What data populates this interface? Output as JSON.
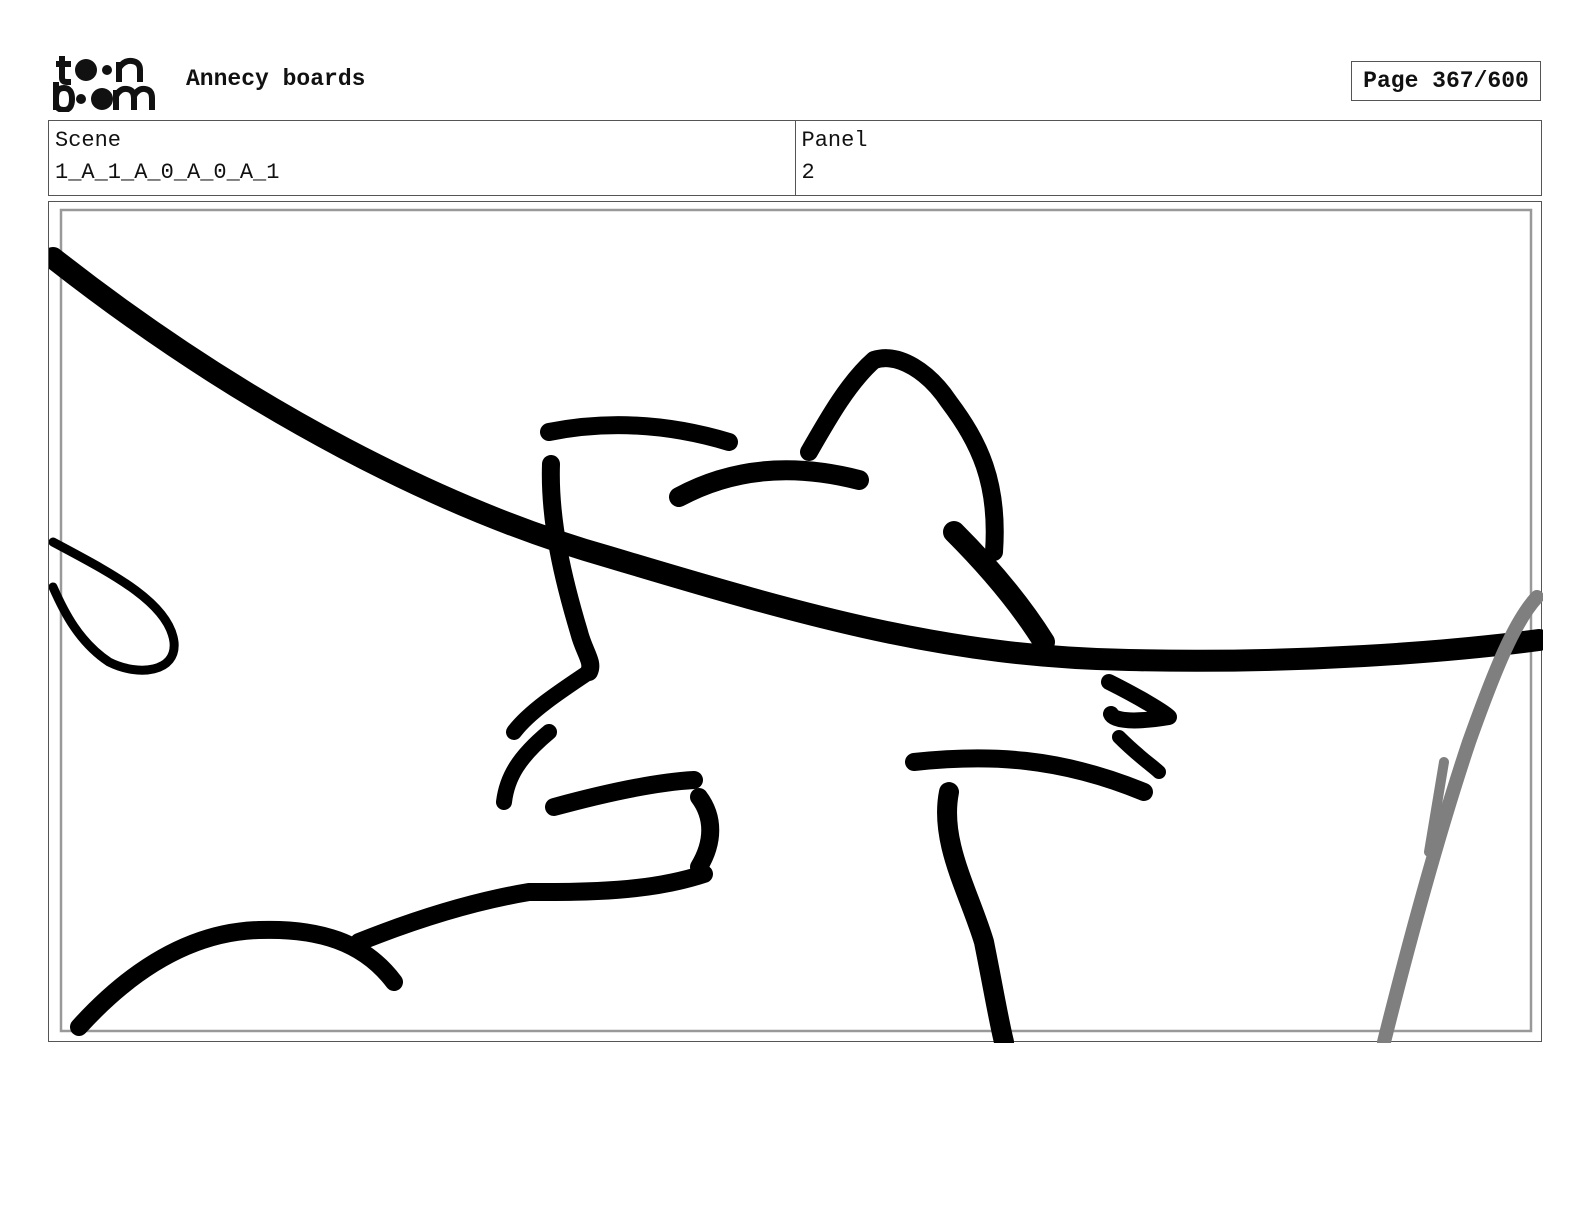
{
  "header": {
    "logo_text_top": "to n",
    "logo_text_bottom": "b om",
    "project_title": "Annecy boards",
    "page_indicator": "Page 367/600"
  },
  "info": {
    "scene_label": "Scene",
    "scene_value": "1_A_1_A_0_A_0_A_1",
    "panel_label": "Panel",
    "panel_value": "2"
  },
  "drawing": {
    "stroke_color": "#000000",
    "grey_stroke_color": "#7f7f7f",
    "safe_frame_color": "#999999"
  }
}
